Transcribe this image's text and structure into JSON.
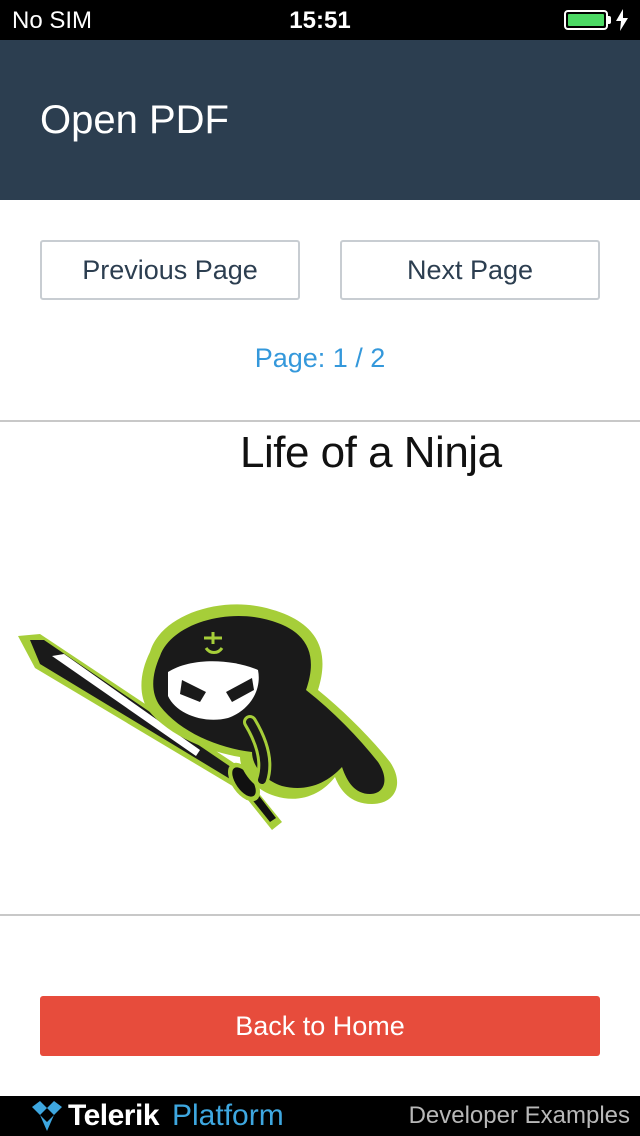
{
  "status_bar": {
    "carrier": "No SIM",
    "time": "15:51",
    "battery_color": "#4cd964"
  },
  "header": {
    "title": "Open PDF"
  },
  "navigation": {
    "previous_label": "Previous Page",
    "next_label": "Next Page"
  },
  "page_indicator": "Page: 1 / 2",
  "pdf": {
    "title": "Life of a Ninja",
    "illustration": "ninja-with-sword"
  },
  "actions": {
    "back_label": "Back to Home"
  },
  "footer": {
    "brand_name": "Telerik",
    "brand_product": "Platform",
    "right_text": "Developer Examples"
  },
  "colors": {
    "header_bg": "#2c3e50",
    "accent_blue": "#3498db",
    "danger_red": "#e74c3c",
    "ninja_green": "#a6ce39"
  },
  "icons": {
    "battery": "battery-icon",
    "charging": "charging-bolt-icon",
    "brand_logo": "telerik-logo-icon"
  }
}
